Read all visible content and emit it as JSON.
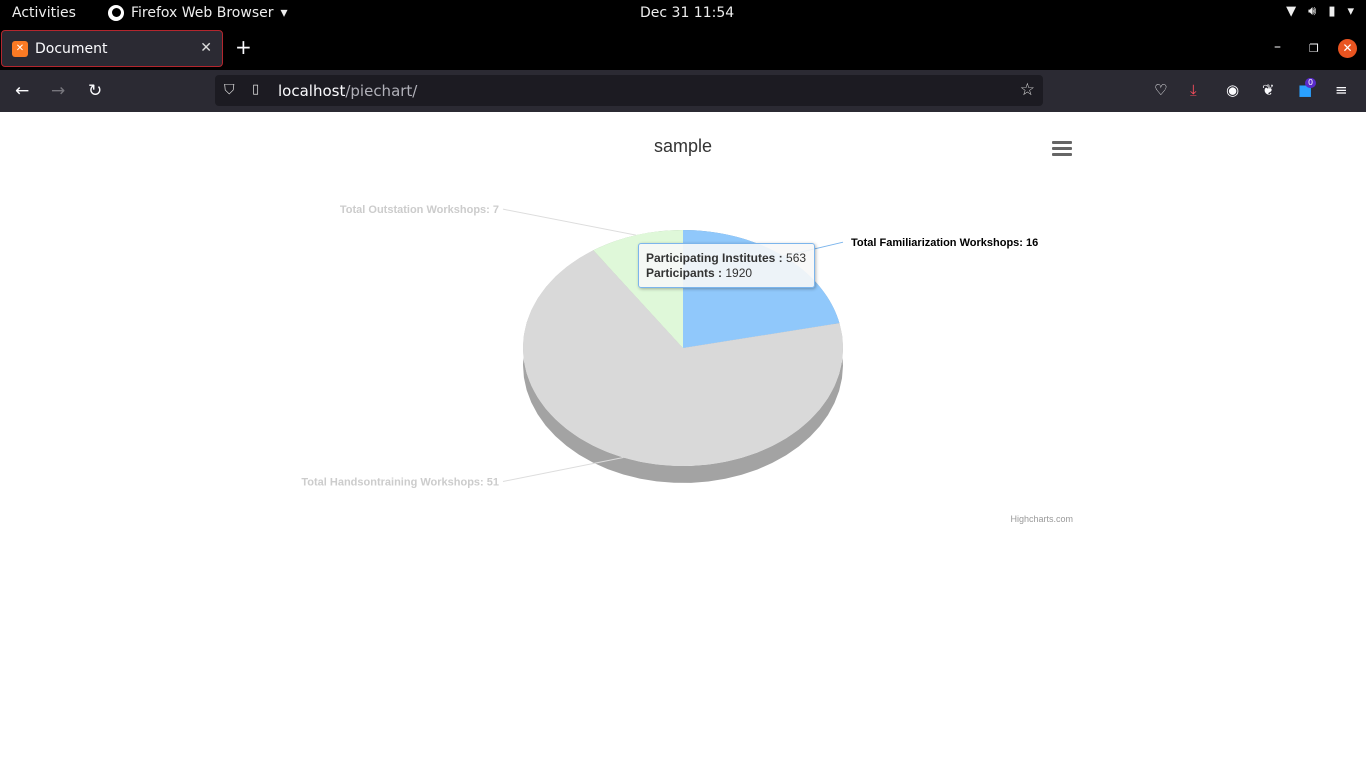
{
  "system_bar": {
    "activities": "Activities",
    "app_name": "Firefox Web Browser",
    "clock": "Dec 31  11:54"
  },
  "browser": {
    "tab_title": "Document",
    "url_host": "localhost",
    "url_path": "/piechart/",
    "extension_badge": "0"
  },
  "chart_data": {
    "type": "pie",
    "title": "sample",
    "three_d": true,
    "series": [
      {
        "name": "",
        "slices": [
          {
            "label": "Total Familiarization Workshops",
            "value": 16,
            "color": "#90c8fb"
          },
          {
            "label": "Total Handsontraining Workshops",
            "value": 51,
            "color": "#d9d9d9"
          },
          {
            "label": "Total Outstation Workshops",
            "value": 7,
            "color": "#dff8d9"
          }
        ]
      }
    ],
    "data_labels": [
      "Total Familiarization Workshops: 16",
      "Total Handsontraining Workshops: 51",
      "Total Outstation Workshops: 7"
    ],
    "hovered_slice": "Total Familiarization Workshops",
    "tooltip": {
      "line1_label": "Participating Institutes :",
      "line1_value": "563",
      "line2_label": "Participants :",
      "line2_value": "1920"
    },
    "credits": "Highcharts.com"
  },
  "colors": {
    "accent": "#7cb5ec",
    "close_button": "#e95420"
  }
}
